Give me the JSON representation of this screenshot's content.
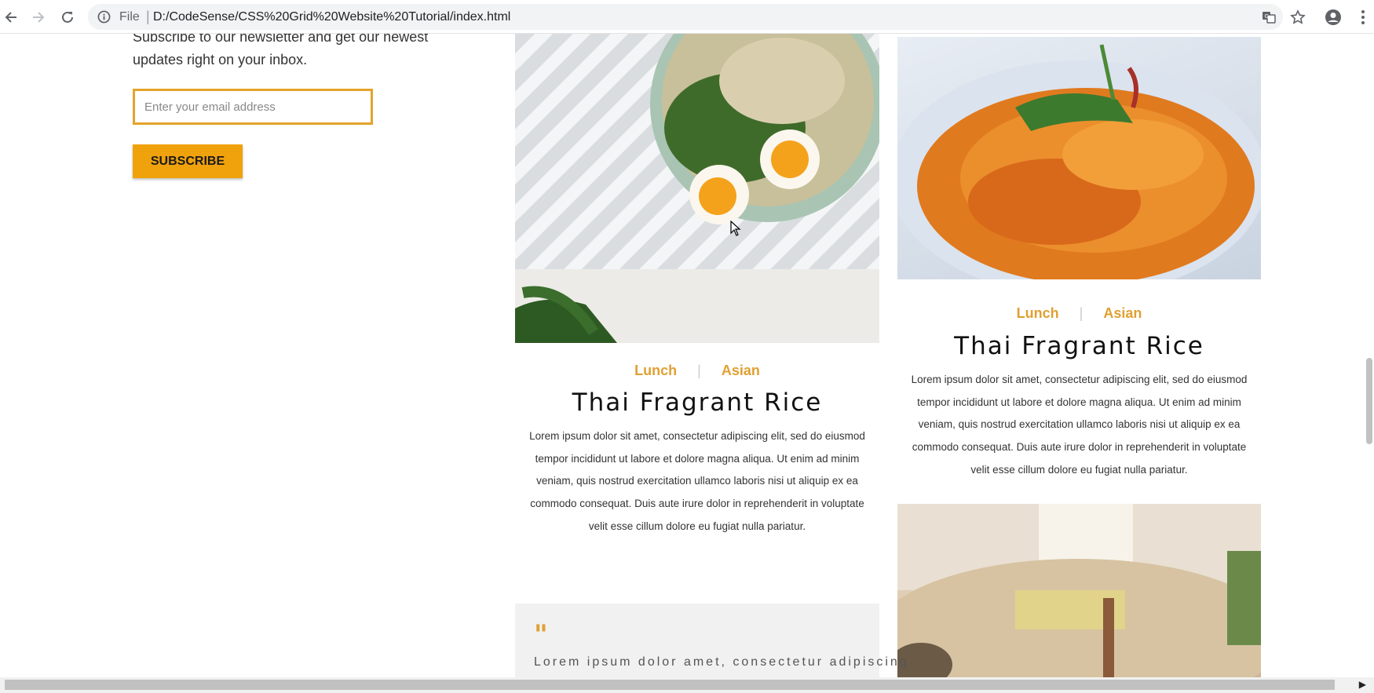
{
  "browser": {
    "file_label": "File",
    "separator": "|",
    "url": "D:/CodeSense/CSS%20Grid%20Website%20Tutorial/index.html",
    "icons": [
      "back-icon",
      "forward-icon",
      "reload-icon",
      "info-icon",
      "translate-icon",
      "star-icon",
      "account-icon",
      "menu-icon"
    ]
  },
  "newsletter": {
    "text": "Subscribe to our newsletter and get our newest updates right on your inbox.",
    "email_placeholder": "Enter your email address",
    "subscribe_label": "SUBSCRIBE"
  },
  "cards": [
    {
      "tag1": "Lunch",
      "tag_sep": "|",
      "tag2": "Asian",
      "title": "Thai Fragrant Rice",
      "text": "Lorem ipsum dolor sit amet, consectetur adipiscing elit, sed do eiusmod tempor incididunt ut labore et dolore magna aliqua. Ut enim ad minim veniam, quis nostrud exercitation ullamco laboris nisi ut aliquip ex ea commodo consequat. Duis aute irure dolor in reprehenderit in voluptate velit esse cillum dolore eu fugiat nulla pariatur."
    },
    {
      "tag1": "Lunch",
      "tag_sep": "|",
      "tag2": "Asian",
      "title": "Thai Fragrant Rice",
      "text": "Lorem ipsum dolor sit amet, consectetur adipiscing elit, sed do eiusmod tempor incididunt ut labore et dolore magna aliqua. Ut enim ad minim veniam, quis nostrud exercitation ullamco laboris nisi ut aliquip ex ea commodo consequat. Duis aute irure dolor in reprehenderit in voluptate velit esse cillum dolore eu fugiat nulla pariatur."
    }
  ],
  "quote": {
    "mark": "\"",
    "text": "Lorem ipsum dolor amet, consectetur adipiscing"
  },
  "colors": {
    "accent": "#f0a20c",
    "tag": "#e0a032"
  }
}
